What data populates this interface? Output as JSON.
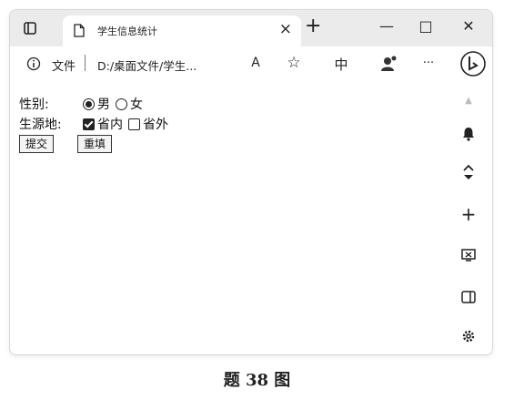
{
  "browser": {
    "tab_title": "学生信息统计",
    "tab_close": "×",
    "new_tab": "+",
    "minimize": "—",
    "maximize": "□",
    "close": "✕",
    "url_prefix": "文件",
    "url": "D:/桌面文件/学生...",
    "read_aloud": "A",
    "favorite": "☆",
    "translate": "中",
    "more": "···"
  },
  "form": {
    "gender_label": "性别:",
    "gender_options": [
      {
        "label": "男",
        "checked": true
      },
      {
        "label": "女",
        "checked": false
      }
    ],
    "origin_label": "生源地:",
    "origin_options": [
      {
        "label": "省内",
        "checked": true
      },
      {
        "label": "省外",
        "checked": false
      }
    ],
    "submit_label": "提交",
    "reset_label": "重填"
  },
  "sidebar": {
    "icons": [
      "bell-icon",
      "chevron-up-down-icon",
      "plus-icon",
      "screenshot-icon",
      "panel-icon",
      "gear-icon"
    ],
    "plus": "+"
  },
  "caption": "题 38 图"
}
